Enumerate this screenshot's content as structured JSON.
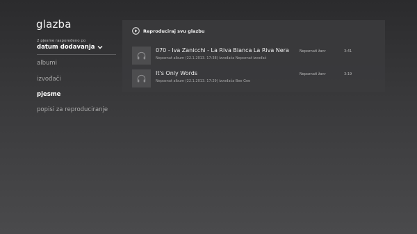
{
  "app": {
    "title": "glazba"
  },
  "sort": {
    "caption": "2 pjesme raspoređeno po",
    "value": "datum dodavanja"
  },
  "nav": {
    "items": [
      {
        "label": "albumi",
        "active": false
      },
      {
        "label": "izvođači",
        "active": false
      },
      {
        "label": "pjesme",
        "active": true
      },
      {
        "label": "popisi za reproduciranje",
        "active": false
      }
    ]
  },
  "panel": {
    "play_all_label": "Reproduciraj svu glazbu",
    "songs": [
      {
        "title": "070 - Iva Zanicchi - La Riva Bianca La Riva Nera",
        "subtitle": "Nepoznat album (22.1.2013. 17:38) izvođača Nepoznat izvođač",
        "genre": "Nepoznati žanr",
        "duration": "3:41",
        "thumb_icon": "headphones-icon"
      },
      {
        "title": "It's Only Words",
        "subtitle": "Nepoznat album (22.1.2013. 17:29) izvođača Bee Gee",
        "genre": "Nepoznati žanr",
        "duration": "3:19",
        "thumb_icon": "headphones-icon"
      }
    ]
  },
  "colors": {
    "background_top": "#2b2b2d",
    "background_bottom": "#4a4a4c",
    "panel": "#3a3a3c",
    "text_primary": "#f0f0f0",
    "text_secondary": "#a9a9a9"
  }
}
